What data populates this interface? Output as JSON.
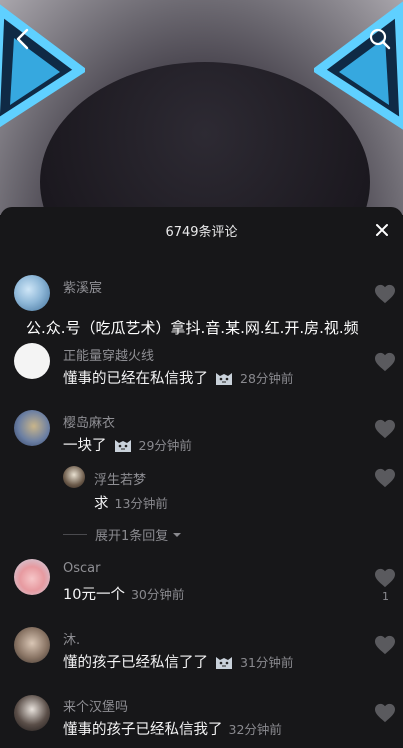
{
  "panel": {
    "title": "6749条评论"
  },
  "comments": [
    {
      "username": "紫溪宸",
      "overlay_text": "公.众.号（吃瓜艺术）拿抖.音.某.网.红.开.房.视.频"
    },
    {
      "username": "正能量穿越火线",
      "text": "懂事的已经在私信我了",
      "time": "28分钟前"
    },
    {
      "username": "樱岛麻衣",
      "text": "一块了",
      "time": "29分钟前"
    },
    {
      "username": "浮生若梦",
      "text": "求",
      "time": "13分钟前"
    },
    {
      "username": "Oscar",
      "text": "10元一个",
      "time": "30分钟前",
      "likes": "1"
    },
    {
      "username": "沐.",
      "text": "懂的孩子已经私信了了",
      "time": "31分钟前"
    },
    {
      "username": "来个汉堡吗",
      "text": "懂事的孩子已经私信我了",
      "time": "32分钟前"
    }
  ],
  "expand_replies": "展开1条回复",
  "colors": {
    "panel_bg": "#171719",
    "muted_text": "#8a8a8f",
    "ear_glow": "#4fc3f7"
  },
  "icons": [
    "back-arrow-icon",
    "search-icon",
    "close-icon",
    "heart-icon",
    "cat-emoji-icon",
    "chevron-down-icon"
  ]
}
